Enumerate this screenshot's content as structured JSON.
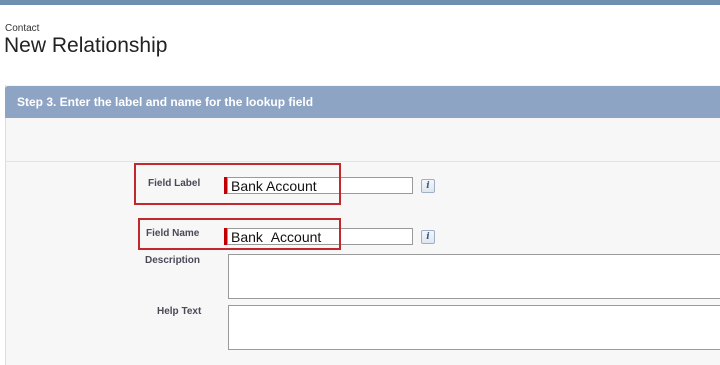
{
  "header": {
    "breadcrumb": "Contact",
    "title": "New Relationship"
  },
  "step": {
    "title": "Step 3. Enter the label and name for the lookup field"
  },
  "fields": {
    "field_label": {
      "label": "Field Label",
      "value": "Bank Account",
      "info_icon": "info-icon"
    },
    "field_name": {
      "label": "Field Name",
      "value": "Bank_Account",
      "info_icon": "info-icon"
    },
    "description": {
      "label": "Description",
      "value": ""
    },
    "help_text": {
      "label": "Help Text",
      "value": ""
    }
  },
  "icons": {
    "info_glyph": "i"
  },
  "colors": {
    "step_header_bg": "#8ea4c5",
    "required_marker": "#c00000",
    "highlight_box": "#c0282e"
  }
}
